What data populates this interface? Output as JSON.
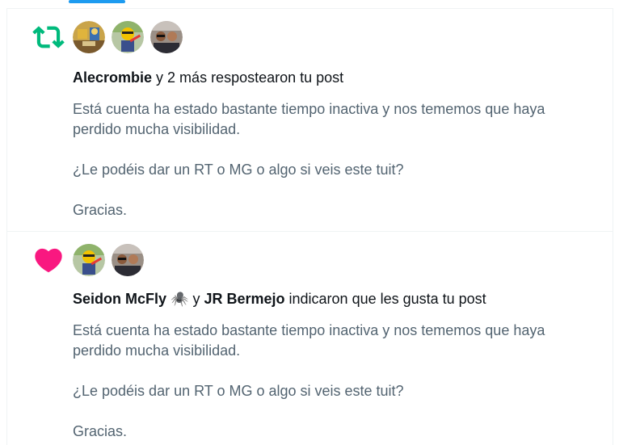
{
  "colors": {
    "accent": "#1d9bf0",
    "repost_green": "#00ba7c",
    "like_pink": "#f91880",
    "text_primary": "#0f1419",
    "text_secondary": "#536471",
    "border": "#eff3f4"
  },
  "notifications": [
    {
      "type": "repost",
      "icon": "repost-icon",
      "avatars": [
        "avatar-alecrombie",
        "avatar-seidon-mcfly",
        "avatar-jr-bermejo"
      ],
      "headline": {
        "name": "Alecrombie",
        "rest": " y 2 más respostearon tu post"
      },
      "post_text": [
        "Está cuenta ha estado bastante tiempo inactiva y nos tememos que haya perdido mucha visibilidad.",
        "¿Le podéis dar un RT o MG o algo si veis este tuit?",
        "Gracias."
      ]
    },
    {
      "type": "like",
      "icon": "heart-icon",
      "avatars": [
        "avatar-seidon-mcfly",
        "avatar-jr-bermejo"
      ],
      "headline": {
        "name1": "Seidon McFly",
        "emoji": "🕷️",
        "connector": " y ",
        "name2": "JR Bermejo",
        "rest": " indicaron que les gusta tu post"
      },
      "post_text": [
        "Está cuenta ha estado bastante tiempo inactiva y nos tememos que haya perdido mucha visibilidad.",
        "¿Le podéis dar un RT o MG o algo si veis este tuit?",
        "Gracias."
      ]
    }
  ]
}
